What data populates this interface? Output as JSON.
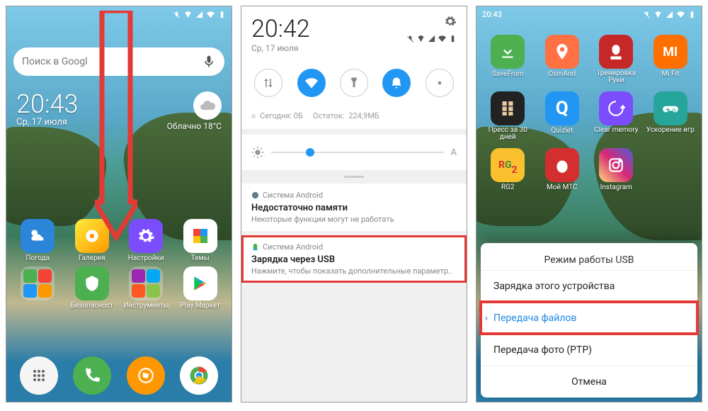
{
  "phone1": {
    "status_time": "",
    "search_placeholder": "Поиск в Googl",
    "clock_time": "20:43",
    "clock_date": "Ср, 17 июля",
    "weather_text": "Облачно 18°C",
    "apps_row1": [
      {
        "label": "Погода",
        "color": "#2b85d8"
      },
      {
        "label": "Галерея",
        "color": "#ffc107"
      },
      {
        "label": "Настройки",
        "color": "#7c4dff"
      },
      {
        "label": "Темы",
        "color": "#ff9800"
      }
    ],
    "apps_row2": [
      {
        "label": "",
        "type": "folder"
      },
      {
        "label": "Безопасност",
        "color": "#4caf50"
      },
      {
        "label": "Инструменты",
        "type": "folder"
      },
      {
        "label": "Play Маркет",
        "color": "#fff"
      }
    ],
    "dock": [
      {
        "name": "phone",
        "color": "#4caf50"
      },
      {
        "name": "messages",
        "color": "#4caf50"
      },
      {
        "name": "browser",
        "color": "#ff9800"
      },
      {
        "name": "camera",
        "color": "#f44336"
      }
    ]
  },
  "phone2": {
    "time": "20:42",
    "date": "Ср, 17 июля",
    "data_today": "Сегодня: 0Б",
    "data_left_label": "Остаток:",
    "data_left": "224,9МБ",
    "notif1": {
      "src": "Система Android",
      "title": "Недостаточно памяти",
      "sub": "Некоторые функции могут не работать"
    },
    "notif2": {
      "src": "Система Android",
      "title": "Зарядка через USB",
      "sub": "Нажмите, чтобы показать дополнительные параметр.."
    }
  },
  "phone3": {
    "status_time": "20:43",
    "apps": [
      {
        "label": "SaveFrom",
        "color": "#4caf50"
      },
      {
        "label": "OsmAnd",
        "color": "#ff7043"
      },
      {
        "label": "Тренировка Руки",
        "color": "#c62828"
      },
      {
        "label": "Mi Fit",
        "color": "#ff6f00"
      },
      {
        "label": "Пресс за 30 дней",
        "color": "#333"
      },
      {
        "label": "Quizlet",
        "color": "#2196f3"
      },
      {
        "label": "Clear memory",
        "color": "#7c4dff"
      },
      {
        "label": "Ускорение игр",
        "color": "#26a69a"
      },
      {
        "label": "RG2",
        "color": "#fbc02d"
      },
      {
        "label": "Мой МТС",
        "color": "#d32f2f"
      },
      {
        "label": "Instagram",
        "color": "#e1306c"
      }
    ],
    "modal": {
      "title": "Режим работы USB",
      "opt1": "Зарядка этого устройства",
      "opt2": "Передача файлов",
      "opt3": "Передача фото (PTP)",
      "cancel": "Отмена"
    }
  }
}
